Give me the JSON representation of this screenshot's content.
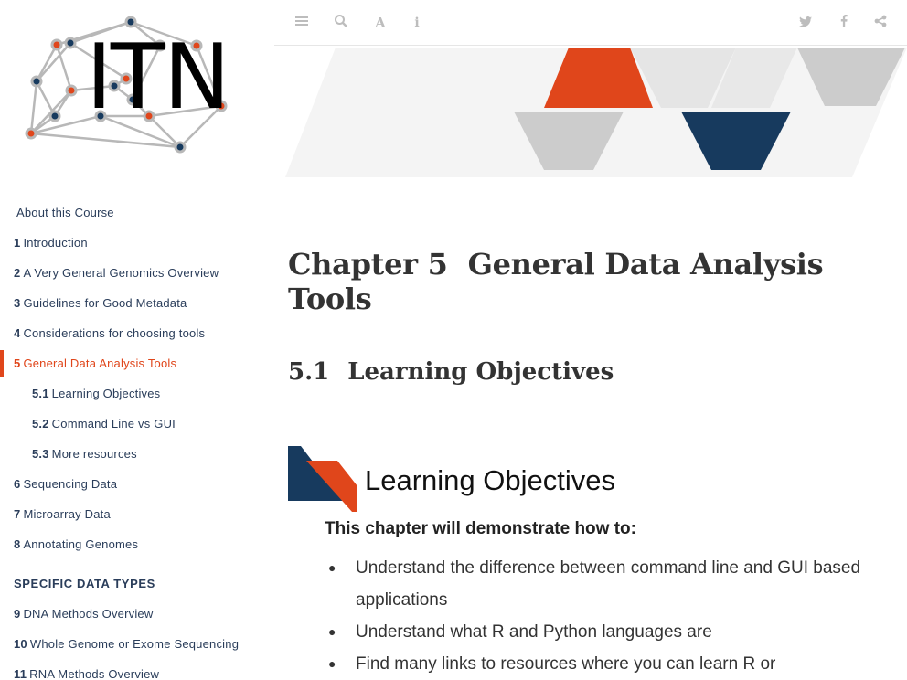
{
  "logo": {
    "text": "ITN"
  },
  "toolbar": {
    "left_icons": [
      "menu-icon",
      "search-icon",
      "font-icon",
      "info-icon"
    ],
    "right_icons": [
      "twitter-icon",
      "facebook-icon",
      "share-icon"
    ]
  },
  "sidebar": {
    "items": [
      {
        "num": "",
        "label": "About this Course"
      },
      {
        "num": "1",
        "label": "Introduction"
      },
      {
        "num": "2",
        "label": "A Very General Genomics Overview"
      },
      {
        "num": "3",
        "label": "Guidelines for Good Metadata"
      },
      {
        "num": "4",
        "label": "Considerations for choosing tools"
      },
      {
        "num": "5",
        "label": "General Data Analysis Tools"
      },
      {
        "num": "5.1",
        "label": "Learning Objectives"
      },
      {
        "num": "5.2",
        "label": "Command Line vs GUI"
      },
      {
        "num": "5.3",
        "label": "More resources"
      },
      {
        "num": "6",
        "label": "Sequencing Data"
      },
      {
        "num": "7",
        "label": "Microarray Data"
      },
      {
        "num": "8",
        "label": "Annotating Genomes"
      }
    ],
    "section_header": "SPECIFIC DATA TYPES",
    "items2": [
      {
        "num": "9",
        "label": "DNA Methods Overview"
      },
      {
        "num": "10",
        "label": "Whole Genome or Exome Sequencing"
      },
      {
        "num": "11",
        "label": "RNA Methods Overview"
      }
    ]
  },
  "main": {
    "chapter_num": "Chapter 5",
    "chapter_title": "General Data Analysis Tools",
    "section_num": "5.1",
    "section_title": "Learning Objectives",
    "lo_title": "Learning Objectives",
    "lo_subtitle": "This chapter will demonstrate how to:",
    "lo_items": [
      "Understand the difference between command line and GUI based applications",
      "Understand what R and Python languages are",
      "Find many links to resources where you can learn R or"
    ]
  },
  "colors": {
    "accent": "#e0461b",
    "navy": "#173a5e",
    "gray": "#cccccc"
  }
}
